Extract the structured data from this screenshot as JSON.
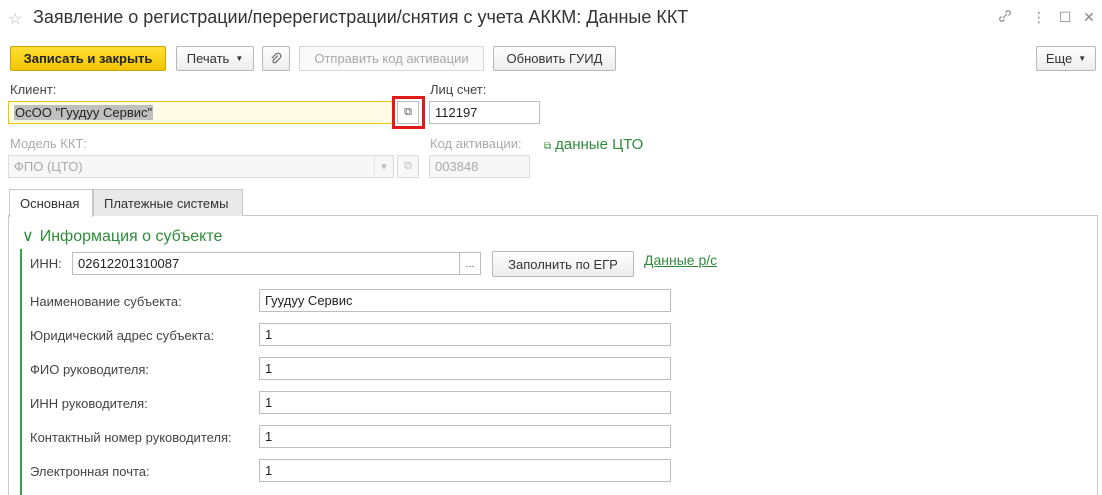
{
  "window": {
    "title": "Заявление о регистрации/перерегистрации/снятия с учета АККМ: Данные ККТ",
    "icons": {
      "star": "☆",
      "link": "🔗",
      "more": "⋮",
      "maximize": "☐",
      "close": "✕"
    }
  },
  "toolbar": {
    "save_close": "Записать и закрыть",
    "print": "Печать",
    "attach_icon": "📎",
    "send_code": "Отправить код активации",
    "update_guid": "Обновить ГУИД",
    "more": "Еще"
  },
  "form": {
    "client_label": "Клиент:",
    "client_value": "ОсОО \"Гуудуу Сервис\"",
    "account_label": "Лиц счет:",
    "account_value": "112197",
    "model_label": "Модель ККТ:",
    "model_value": "ФПО (ЦТО)",
    "activation_label": "Код активации:",
    "activation_value": "003848",
    "cto_link": "данные ЦТО",
    "open_icon": "⧉",
    "dropdown_icon": "▾"
  },
  "tabs": [
    {
      "label": "Основная"
    },
    {
      "label": "Платежные системы"
    }
  ],
  "subject": {
    "group_title": "Информация о субъекте",
    "chevron": "∨",
    "inn_label": "ИНН:",
    "inn_value": "02612201310087",
    "ellipsis": "...",
    "fill_button": "Заполнить по ЕГР",
    "bank_link": "Данные р/с",
    "fields": [
      {
        "label": "Наименование субъекта:",
        "value": "Гуудуу Сервис"
      },
      {
        "label": "Юридический адрес субъекта:",
        "value": "1"
      },
      {
        "label": "ФИО руководителя:",
        "value": "1"
      },
      {
        "label": "ИНН руководителя:",
        "value": "1"
      },
      {
        "label": "Контактный номер руководителя:",
        "value": "1"
      },
      {
        "label": "Электронная почта:",
        "value": "1"
      }
    ]
  }
}
